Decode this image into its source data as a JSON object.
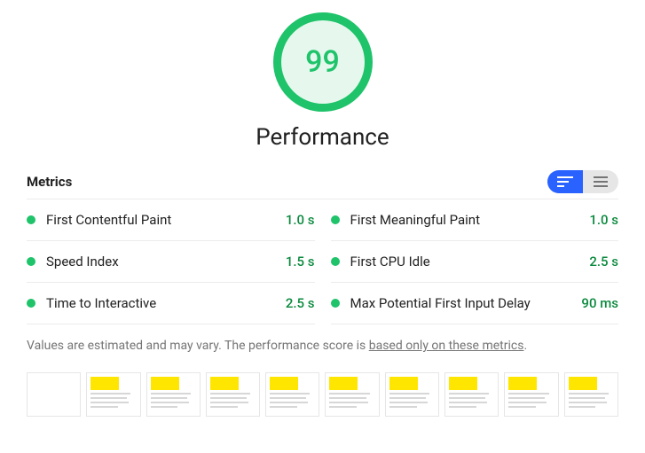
{
  "score": {
    "value": "99",
    "label": "Performance"
  },
  "metrics_heading": "Metrics",
  "metrics": [
    {
      "name": "First Contentful Paint",
      "value": "1.0 s"
    },
    {
      "name": "First Meaningful Paint",
      "value": "1.0 s"
    },
    {
      "name": "Speed Index",
      "value": "1.5 s"
    },
    {
      "name": "First CPU Idle",
      "value": "2.5 s"
    },
    {
      "name": "Time to Interactive",
      "value": "2.5 s"
    },
    {
      "name": "Max Potential First Input Delay",
      "value": "90 ms"
    }
  ],
  "footnote": {
    "prefix": "Values are estimated and may vary. The performance score is ",
    "link": "based only on these metrics",
    "suffix": "."
  },
  "filmstrip_count": 10,
  "thumbnails_blank_first": true
}
